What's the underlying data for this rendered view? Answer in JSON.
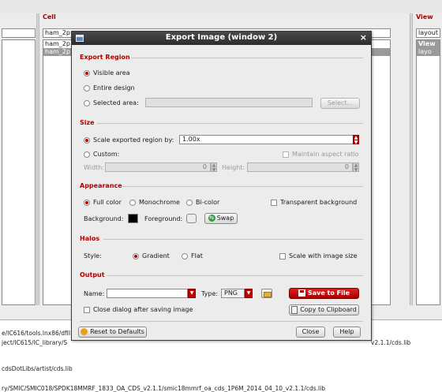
{
  "background": {
    "panes": {
      "left": {
        "rows": [
          "",
          ""
        ]
      },
      "cell": {
        "header": "Cell",
        "filter_value": "ham_2p",
        "rows": [
          "ham_2p",
          "ham_2p"
        ]
      },
      "view": {
        "header": "View",
        "filter_value": "layout",
        "rows": [
          "View",
          "layo"
        ]
      }
    },
    "log_lines": [
      "e/IC616/tools.lnx86/dfII",
      "ject/IC615/IC_library/S",
      "cdsDotLibs/artist/cds.lib",
      "ry/SMIC/SMIC018/SPDK18MMRF_1833_OA_CDS_v2.1.1/smic18mmrf_oa_cds_1P6M_2014_04_10_v2.1.1/cds.lib"
    ],
    "log_tail": "v2.1.1/cds.lib"
  },
  "dialog": {
    "title": "Export Image (window 2)",
    "close_glyph": "×",
    "export_region": {
      "header": "Export Region",
      "visible_area": "Visible area",
      "entire_design": "Entire design",
      "selected_area": "Selected area:",
      "selected_value": "",
      "select_button": "Select..."
    },
    "size": {
      "header": "Size",
      "scale_label": "Scale exported region by:",
      "scale_value": "1.00x",
      "custom_label": "Custom:",
      "maintain_aspect": "Maintain aspect ratio",
      "width_label": "Width:",
      "width_value": "0",
      "height_label": "Height:",
      "height_value": "0"
    },
    "appearance": {
      "header": "Appearance",
      "full_color": "Full color",
      "monochrome": "Monochrome",
      "bi_color": "Bi-color",
      "transparent_bg": "Transparent background",
      "background_label": "Background:",
      "foreground_label": "Foreground:",
      "swap_label": "Swap",
      "background_color": "#000000",
      "foreground_color": "#ececec"
    },
    "halos": {
      "header": "Halos",
      "style_label": "Style:",
      "gradient": "Gradient",
      "flat": "Flat",
      "scale_with_image": "Scale with image size"
    },
    "output": {
      "header": "Output",
      "name_label": "Name:",
      "name_value": "",
      "type_label": "Type:",
      "type_value": "PNG",
      "save_button": "Save to File",
      "close_after_save": "Close dialog after saving image",
      "clipboard_button": "Copy to Clipboard"
    },
    "footer": {
      "reset_button": "Reset to Defaults",
      "close_button": "Close",
      "help_button": "Help"
    }
  },
  "colors": {
    "accent": "#c00000",
    "section_header": "#b00000",
    "titlebar": "#333333"
  }
}
